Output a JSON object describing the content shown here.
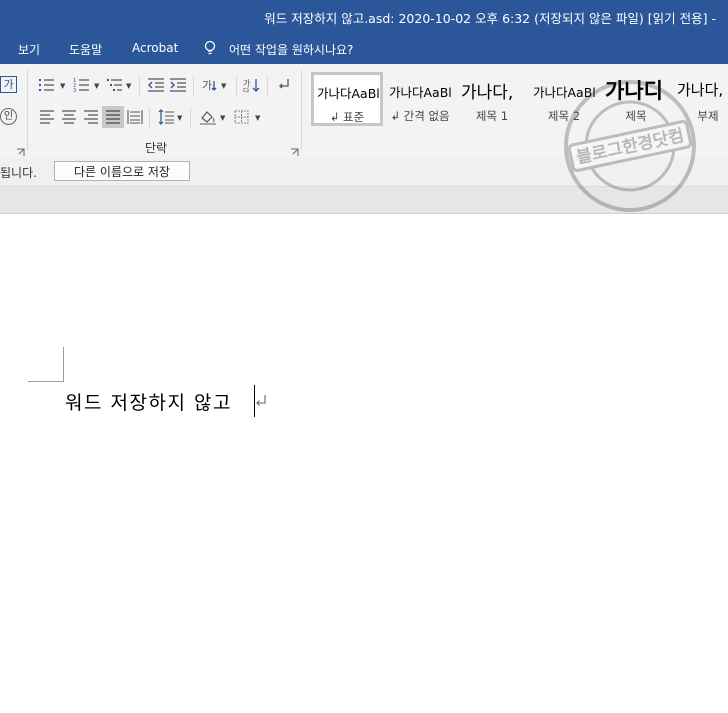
{
  "window": {
    "title": "워드 저장하지 않고.asd: 2020-10-02 오후 6:32 (저장되지 않은 파일) [읽기 전용]  -"
  },
  "tabs": [
    {
      "label": "보기"
    },
    {
      "label": "도움말"
    },
    {
      "label": "Acrobat"
    }
  ],
  "tell_me": {
    "placeholder": "어떤 작업을 원하시나요?"
  },
  "ribbon": {
    "font_group_partial": {
      "icon_top": "가",
      "icon_bottom": "인"
    },
    "paragraph_label": "단락",
    "styles": [
      {
        "preview": "가나다AaBl",
        "name": "↲ 표준",
        "selected": true
      },
      {
        "preview": "가나다AaBl",
        "name": "↲ 간격 없음",
        "selected": false
      },
      {
        "preview": "가나다,",
        "name": "제목 1",
        "selected": false
      },
      {
        "preview": "가나다AaBl",
        "name": "제목 2",
        "selected": false
      },
      {
        "preview": "가나디",
        "name": "제목",
        "selected": false
      },
      {
        "preview": "가나다,",
        "name": "부제",
        "selected": false
      }
    ]
  },
  "infobar": {
    "message_partial": "됩니다.",
    "save_as_label": "다른 이름으로 저장"
  },
  "document": {
    "text": "워드 저장하지 않고 "
  },
  "watermark": {
    "center": "블로그한경닷컴",
    "ring": "블로그한경닷컴"
  },
  "colors": {
    "title_bar": "#2b579a",
    "ribbon": "#f3f3f3",
    "infobar": "#f0f0f0"
  }
}
